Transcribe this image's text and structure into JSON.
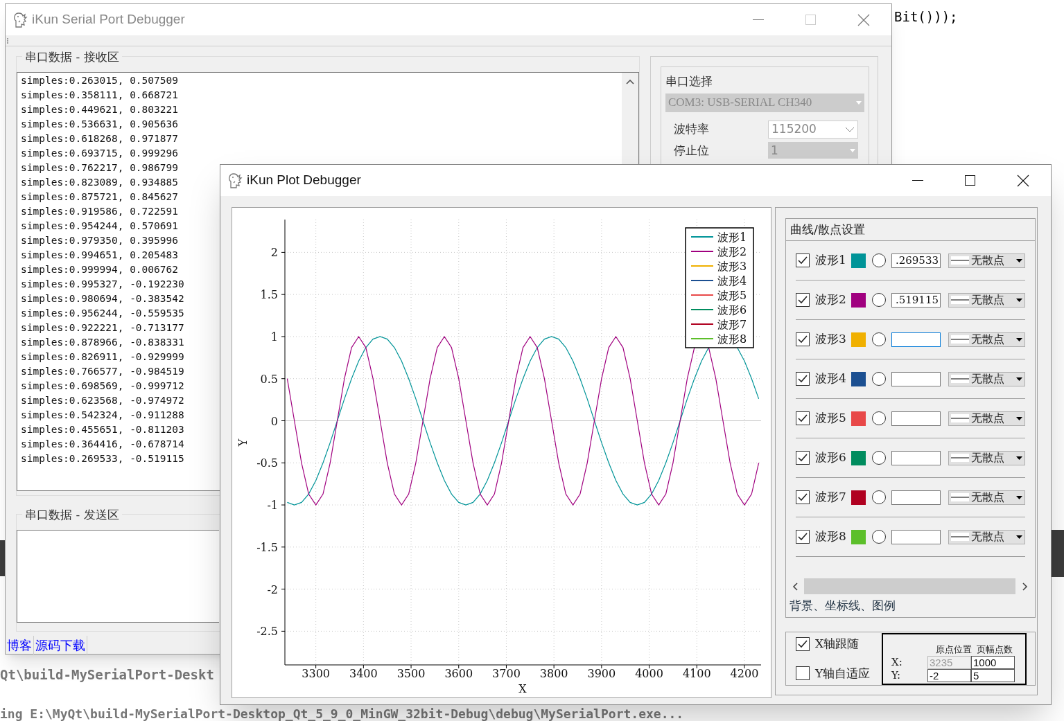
{
  "code_editor": {
    "code_fragment": "Bit()));",
    "console_lines": [
      "Qt\\build-MySerialPort-Deskt",
      "ing E:\\MyQt\\build-MySerialPort-Desktop_Qt_5_9_0_MinGW_32bit-Debug\\debug\\MySerialPort.exe..."
    ]
  },
  "serial_window": {
    "title": "iKun Serial Port Debugger",
    "receive_group": {
      "title": "串口数据 - 接收区",
      "lines": [
        "simples:0.263015, 0.507509",
        "simples:0.358111, 0.668721",
        "simples:0.449621, 0.803221",
        "simples:0.536631, 0.905636",
        "simples:0.618268, 0.971877",
        "simples:0.693715, 0.999296",
        "simples:0.762217, 0.986799",
        "simples:0.823089, 0.934885",
        "simples:0.875721, 0.845627",
        "simples:0.919586, 0.722591",
        "simples:0.954244, 0.570691",
        "simples:0.979350, 0.395996",
        "simples:0.994651, 0.205483",
        "simples:0.999994, 0.006762",
        "simples:0.995327, -0.192230",
        "simples:0.980694, -0.383542",
        "simples:0.956244, -0.559535",
        "simples:0.922221, -0.713177",
        "simples:0.878966, -0.838331",
        "simples:0.826911, -0.929999",
        "simples:0.766577, -0.984519",
        "simples:0.698569, -0.999712",
        "simples:0.623568, -0.974972",
        "simples:0.542324, -0.911288",
        "simples:0.455651, -0.811203",
        "simples:0.364416, -0.678714",
        "simples:0.269533, -0.519115"
      ]
    },
    "send_group": {
      "title": "串口数据 - 发送区"
    },
    "links": [
      "博客",
      "源码下载"
    ],
    "port_group": {
      "title": "串口选择",
      "port": {
        "value": "COM3: USB-SERIAL CH340",
        "disabled": true
      },
      "fields": [
        {
          "label": "波特率",
          "value": "115200",
          "disabled": false
        },
        {
          "label": "停止位",
          "value": "1",
          "disabled": true
        }
      ]
    }
  },
  "plot_window": {
    "title": "iKun Plot Debugger",
    "chart_data": {
      "type": "line",
      "grid": true,
      "legend": true,
      "xlabel": "X",
      "ylabel": "Y",
      "xlim": [
        3235,
        4235
      ],
      "ylim": [
        -2.9,
        2.39
      ],
      "xticks": [
        3300,
        3400,
        3500,
        3600,
        3700,
        3800,
        3900,
        4000,
        4100,
        4200
      ],
      "yticks": [
        -2.5,
        -2,
        -1.5,
        -1,
        -0.5,
        0,
        0.5,
        1,
        1.5,
        2
      ],
      "x": [
        3240,
        3255,
        3270,
        3285,
        3300,
        3315,
        3330,
        3345,
        3360,
        3375,
        3390,
        3405,
        3420,
        3435,
        3450,
        3465,
        3480,
        3495,
        3510,
        3525,
        3540,
        3555,
        3570,
        3585,
        3600,
        3615,
        3630,
        3645,
        3660,
        3675,
        3690,
        3705,
        3720,
        3735,
        3750,
        3765,
        3780,
        3795,
        3810,
        3825,
        3840,
        3855,
        3870,
        3885,
        3900,
        3915,
        3930,
        3945,
        3960,
        3975,
        3990,
        4005,
        4020,
        4035,
        4050,
        4065,
        4080,
        4095,
        4110,
        4125,
        4140,
        4155,
        4170,
        4185,
        4200,
        4215,
        4230
      ],
      "series": [
        {
          "name": "波形1",
          "color": "#009498",
          "values": [
            -0.97,
            -1,
            -0.97,
            -0.87,
            -0.71,
            -0.5,
            -0.26,
            0,
            0.26,
            0.5,
            0.71,
            0.87,
            0.97,
            1,
            0.97,
            0.87,
            0.71,
            0.5,
            0.26,
            0,
            -0.26,
            -0.5,
            -0.71,
            -0.87,
            -0.97,
            -1,
            -0.97,
            -0.87,
            -0.71,
            -0.5,
            -0.26,
            0,
            0.26,
            0.5,
            0.71,
            0.87,
            0.97,
            1,
            0.97,
            0.87,
            0.71,
            0.5,
            0.26,
            0,
            -0.26,
            -0.5,
            -0.71,
            -0.87,
            -0.97,
            -1,
            -0.97,
            -0.87,
            -0.71,
            -0.5,
            -0.26,
            0,
            0.26,
            0.5,
            0.71,
            0.87,
            null,
            null,
            null,
            0.87,
            0.71,
            0.5,
            0.26
          ]
        },
        {
          "name": "波形2",
          "color": "#a0007f",
          "values": [
            0.5,
            0,
            -0.5,
            -0.87,
            -1,
            -0.87,
            -0.5,
            0,
            0.5,
            0.87,
            1,
            0.87,
            0.5,
            0,
            -0.5,
            -0.87,
            -1,
            -0.87,
            -0.5,
            0,
            0.5,
            0.87,
            1,
            0.87,
            0.5,
            0,
            -0.5,
            -0.87,
            -1,
            -0.87,
            -0.5,
            0,
            0.5,
            0.87,
            1,
            0.87,
            0.5,
            0,
            -0.5,
            -0.87,
            -1,
            -0.87,
            -0.5,
            0,
            0.5,
            0.87,
            1,
            0.87,
            0.5,
            0,
            -0.5,
            -0.87,
            -1,
            -0.87,
            -0.5,
            0,
            0.5,
            0.87,
            null,
            0.87,
            0.5,
            0,
            -0.5,
            -0.87,
            -1,
            -0.87,
            -0.5
          ]
        }
      ]
    },
    "more_legend": [
      {
        "label": "波形3",
        "color": "#f0b000"
      },
      {
        "label": "波形4",
        "color": "#1b4f91"
      },
      {
        "label": "波形5",
        "color": "#e84848"
      },
      {
        "label": "波形6",
        "color": "#008c5e"
      },
      {
        "label": "波形7",
        "color": "#b00020"
      },
      {
        "label": "波形8",
        "color": "#5cbf2a"
      }
    ],
    "curve_settings": {
      "title": "曲线/散点设置",
      "rows": [
        {
          "label": "波形1",
          "color": "#009498",
          "checked": true,
          "selected": false,
          "value": ".269533",
          "focused": false,
          "style": "无散点"
        },
        {
          "label": "波形2",
          "color": "#a0007f",
          "checked": true,
          "selected": false,
          "value": ".519115",
          "focused": false,
          "style": "无散点"
        },
        {
          "label": "波形3",
          "color": "#f0b000",
          "checked": true,
          "selected": false,
          "focused": true,
          "style": "无散点"
        },
        {
          "label": "波形4",
          "color": "#1b4f91",
          "checked": true,
          "selected": false,
          "focused": false,
          "style": "无散点"
        },
        {
          "label": "波形5",
          "color": "#e84848",
          "checked": true,
          "selected": false,
          "focused": false,
          "style": "无散点"
        },
        {
          "label": "波形6",
          "color": "#008c5e",
          "checked": true,
          "selected": false,
          "focused": false,
          "style": "无散点"
        },
        {
          "label": "波形7",
          "color": "#b00020",
          "checked": true,
          "selected": false,
          "focused": false,
          "style": "无散点"
        },
        {
          "label": "波形8",
          "color": "#5cbf2a",
          "checked": true,
          "selected": false,
          "focused": false,
          "style": "无散点"
        }
      ],
      "tab": "背景、坐标线、图例"
    },
    "axis_settings": {
      "options": [
        {
          "label": "X轴跟随",
          "checked": true
        },
        {
          "label": "Y轴自适应",
          "checked": false
        }
      ],
      "columns": [
        "原点位置",
        "页幅点数"
      ],
      "rows": [
        {
          "label": "X:",
          "origin": "3235",
          "origin_disabled": true,
          "span": "1000"
        },
        {
          "label": "Y:",
          "origin": "-2",
          "origin_disabled": false,
          "span": "5"
        }
      ]
    }
  }
}
